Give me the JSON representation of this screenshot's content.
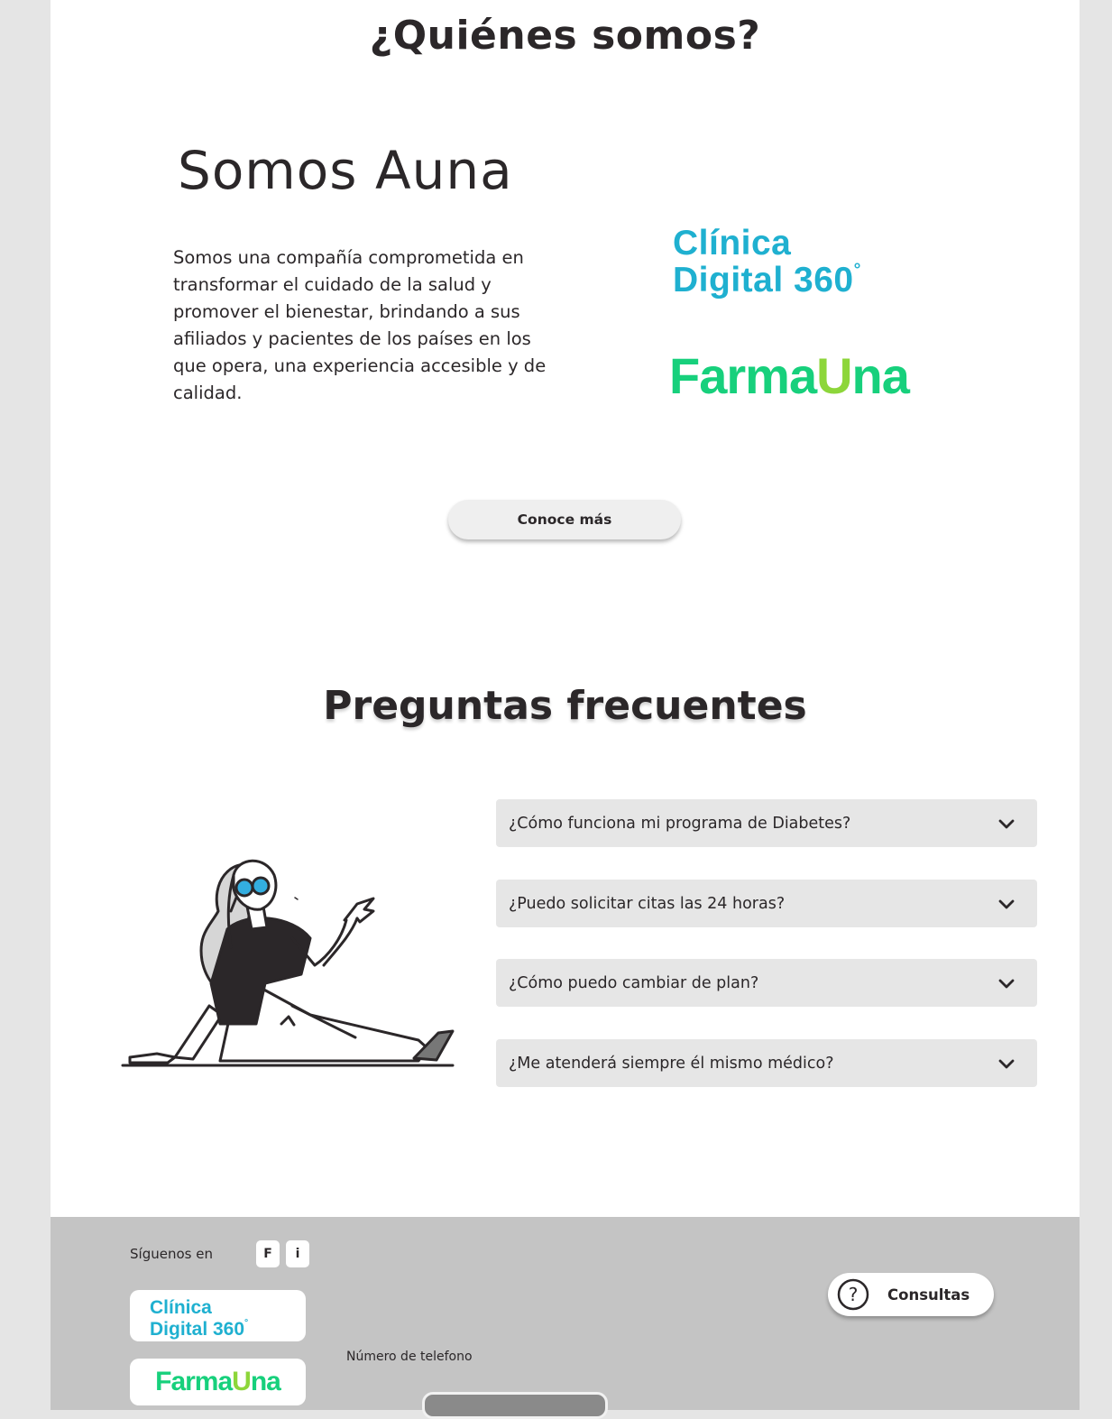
{
  "about": {
    "title": "¿Quiénes somos?",
    "heading": "Somos Auna",
    "description": "Somos una compañía comprometida en transformar el cuidado de la salud y promover el bienestar, brindando a sus afiliados y pacientes de los países en los que opera, una experiencia accesible y de calidad.",
    "cta_label": "Conoce más"
  },
  "logos": {
    "clinica_line1": "Clínica",
    "clinica_line2": "Digital 360",
    "clinica_degree": "°",
    "farma_part1": "Farma",
    "farma_u": "U",
    "farma_part2": "na"
  },
  "faq": {
    "title": "Preguntas frecuentes",
    "items": [
      {
        "question": "¿Cómo funciona mi programa de Diabetes?"
      },
      {
        "question": "¿Puedo solicitar citas las 24 horas?"
      },
      {
        "question": "¿Cómo puedo cambiar de plan?"
      },
      {
        "question": "¿Me atenderá siempre él mismo médico?"
      }
    ]
  },
  "footer": {
    "follow_label": "Síguenos en",
    "social": [
      "F",
      "i"
    ],
    "phone_label": "Número de telefono",
    "consultas_label": "Consultas",
    "consultas_icon": "?"
  },
  "colors": {
    "clinica_blue": "#1fb0d0",
    "farma_green": "#17d07c",
    "farma_lime": "#8dd63a",
    "page_bg": "#ffffff",
    "side_bg": "#e5e5e5",
    "footer_bg": "#c4c4c4",
    "faq_bg": "#e6e6e6",
    "text": "#2b2729",
    "illustration_accent": "#33aee0"
  },
  "icons": {
    "faq_toggle": "chevron-down-icon",
    "consultas": "question-circle-icon"
  }
}
